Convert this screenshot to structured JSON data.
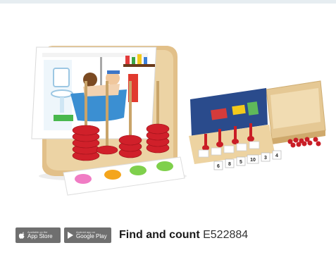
{
  "badges": {
    "app_store": {
      "small_text": "Available on the",
      "label": "App Store",
      "icon": "apple-icon"
    },
    "google_play": {
      "small_text": "Android app on",
      "label": "Google Play",
      "icon": "play-icon"
    }
  },
  "product": {
    "name": "Find and count",
    "code": "E522884"
  },
  "scene": {
    "card_numbers": [
      "6",
      "8",
      "5",
      "10",
      "3",
      "4"
    ]
  },
  "colors": {
    "bead_red": "#d0202a",
    "wood": "#e2c089",
    "strip_bg": "#e6edf1"
  }
}
